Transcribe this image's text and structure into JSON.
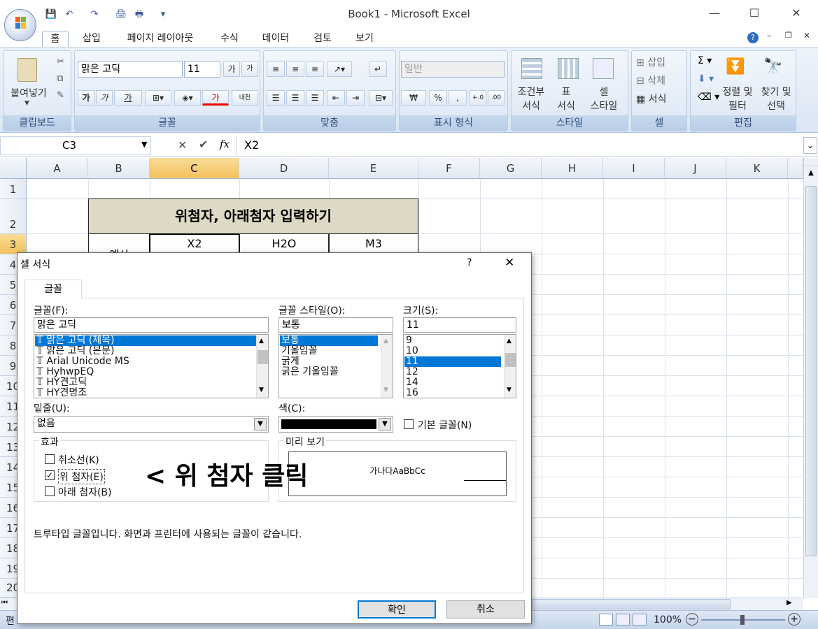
{
  "window": {
    "title": "Book1 - Microsoft Excel",
    "min": "—",
    "max": "☐",
    "close": "✕"
  },
  "qat": {
    "save": "💾",
    "undo": "↶",
    "redo": "↷",
    "print_preview": "🖨",
    "print": "🖶",
    "more": "▾"
  },
  "tabs": [
    "홈",
    "삽입",
    "페이지 레이아웃",
    "수식",
    "데이터",
    "검토",
    "보기"
  ],
  "ribbon": {
    "clipboard": {
      "label": "클립보드",
      "paste": "붙여넣기"
    },
    "font": {
      "label": "글꼴",
      "font_name": "맑은 고딕",
      "font_size": "11",
      "grow": "가",
      "shrink": "가",
      "bold": "가",
      "italic": "가",
      "underline": "가",
      "font_color": "가",
      "phonetic": "내천"
    },
    "align": {
      "label": "맞춤"
    },
    "number": {
      "label": "표시 형식",
      "format": "일반",
      "currency": "₩",
      "percent": "%",
      "comma": ","
    },
    "styles": {
      "label": "스타일",
      "cond_format_1": "조건부",
      "cond_format_2": "서식",
      "table_format_1": "표",
      "table_format_2": "서식",
      "cell_style_1": "셀",
      "cell_style_2": "스타일"
    },
    "cells": {
      "label": "셀",
      "insert": "삽입",
      "delete": "삭제",
      "format": "서식"
    },
    "editing": {
      "label": "편집",
      "sort_1": "정렬 및",
      "sort_2": "필터",
      "find_1": "찾기 및",
      "find_2": "선택"
    }
  },
  "formula_bar": {
    "name_box": "C3",
    "value": "X2",
    "fx": "fx"
  },
  "columns": [
    "A",
    "B",
    "C",
    "D",
    "E",
    "F",
    "G",
    "H",
    "I",
    "J",
    "K"
  ],
  "rows": [
    "1",
    "2",
    "3",
    "4",
    "5",
    "6",
    "7",
    "8",
    "9",
    "10",
    "11",
    "12",
    "13",
    "14",
    "15",
    "16",
    "17",
    "18",
    "19",
    "20"
  ],
  "sheet": {
    "title_cell": "위첨자, 아래첨자 입력하기",
    "example_label": "예시",
    "c3": "X2",
    "d3": "H2O",
    "e3": "M3"
  },
  "status": {
    "mode": "편",
    "zoom": "100%"
  },
  "dialog": {
    "title": "셀 서식",
    "help": "?",
    "close": "✕",
    "tab": "글꼴",
    "font_label": "글꼴(F):",
    "font_value": "맑은 고딕",
    "font_list": [
      "맑은 고딕 (제목)",
      "맑은 고딕 (본문)",
      "Arial Unicode MS",
      "HyhwpEQ",
      "HY견고딕",
      "HY견명조"
    ],
    "style_label": "글꼴 스타일(O):",
    "style_value": "보통",
    "style_list": [
      "보통",
      "기울임꼴",
      "굵게",
      "굵은 기울임꼴"
    ],
    "size_label": "크기(S):",
    "size_value": "11",
    "size_list": [
      "9",
      "10",
      "11",
      "12",
      "14",
      "16"
    ],
    "underline_label": "밑줄(U):",
    "underline_value": "없음",
    "color_label": "색(C):",
    "color_value": "#000000",
    "normal_font_label": "기본 글꼴(N)",
    "effects_label": "효과",
    "strike_label": "취소선(K)",
    "super_label": "위 첨자(E)",
    "sub_label": "아래 첨자(B)",
    "preview_label": "미리 보기",
    "preview_text": "가나다AaBbCc",
    "annotation": "< 위 첨자 클릭",
    "info": "트루타입 글꼴입니다. 화면과 프린터에 사용되는 글꼴이 같습니다.",
    "ok": "확인",
    "cancel": "취소"
  }
}
